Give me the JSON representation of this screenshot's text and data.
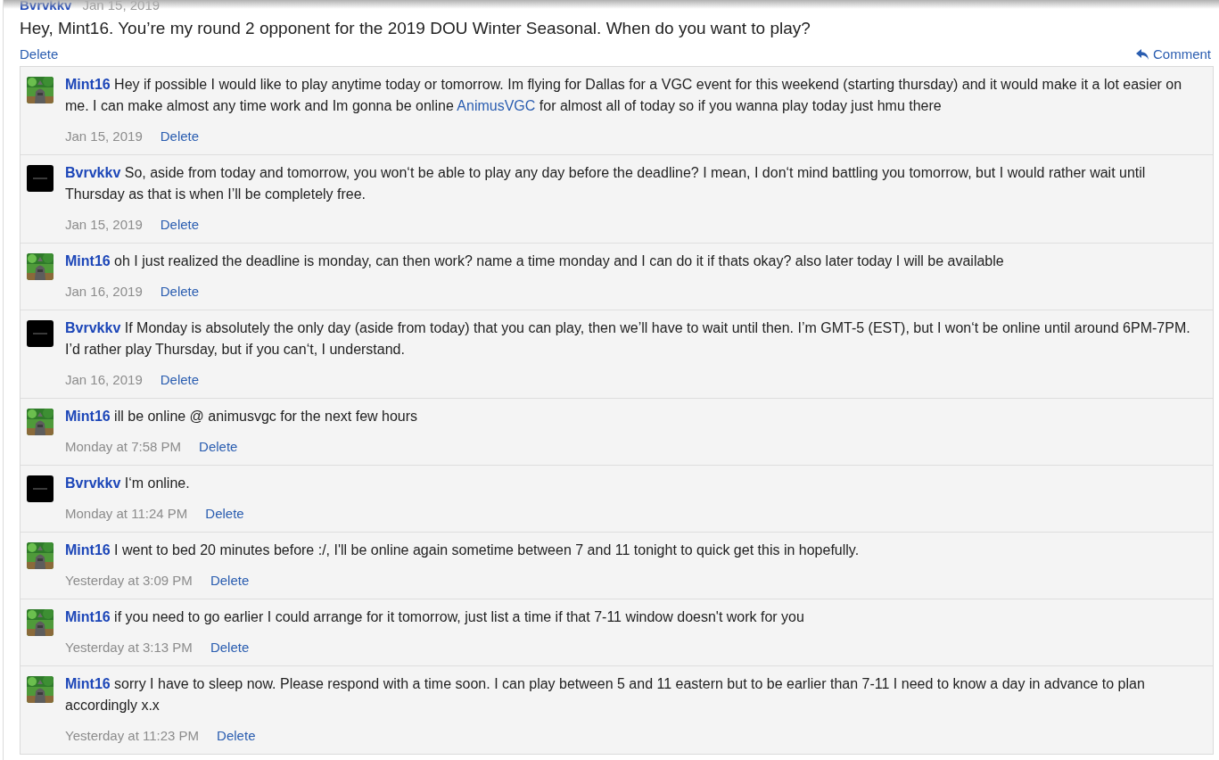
{
  "post_header": {
    "author": "Bvrvkkv",
    "date": "Jan 15, 2019"
  },
  "message": "Hey, Mint16. You’re my round 2 opponent for the 2019 DOU Winter Seasonal. When do you want to play?",
  "message_actions": {
    "delete": "Delete",
    "comment": "Comment"
  },
  "comments": [
    {
      "author": "Mint16",
      "avatar": {
        "kind": "grass"
      },
      "text_before": "Hey if possible I would like to play anytime today or tomorrow. Im flying for Dallas for a VGC event for this weekend (starting thursday) and it would make it a lot easier on me. I can make almost any time work and Im gonna be online",
      "link": "AnimusVGC",
      "text_after": "for almost all of today so if you wanna play today just hmu there",
      "date": "Jan 15, 2019",
      "delete": "Delete"
    },
    {
      "author": "Bvrvkkv",
      "avatar": {
        "kind": "dark"
      },
      "text_before": "So, aside from today and tomorrow, you won‘t be able to play any day before the deadline? I mean, I don‘t mind battling you tomorrow, but I would rather wait until Thursday as that is when I’ll be completely free.",
      "date": "Jan 15, 2019",
      "delete": "Delete"
    },
    {
      "author": "Mint16",
      "avatar": {
        "kind": "grass"
      },
      "text_before": "oh I just realized the deadline is monday, can then work? name a time monday and I can do it if thats okay? also later today I will be available",
      "date": "Jan 16, 2019",
      "delete": "Delete"
    },
    {
      "author": "Bvrvkkv",
      "avatar": {
        "kind": "dark"
      },
      "text_before": "If Monday is absolutely the only day (aside from today) that you can play, then we’ll have to wait until then. I’m GMT-5 (EST), but I won‘t be online until around 6PM-7PM. I’d rather play Thursday, but if you can‘t, I understand.",
      "date": "Jan 16, 2019",
      "delete": "Delete"
    },
    {
      "author": "Mint16",
      "avatar": {
        "kind": "grass"
      },
      "text_before": "ill be online @ animusvgc for the next few hours",
      "date": "Monday at 7:58 PM",
      "delete": "Delete"
    },
    {
      "author": "Bvrvkkv",
      "avatar": {
        "kind": "dark"
      },
      "text_before": "I‘m online.",
      "date": "Monday at 11:24 PM",
      "delete": "Delete"
    },
    {
      "author": "Mint16",
      "avatar": {
        "kind": "grass"
      },
      "text_before": "I went to bed 20 minutes before :/, I'll be online again sometime between 7 and 11 tonight to quick get this in hopefully.",
      "date": "Yesterday at 3:09 PM",
      "delete": "Delete"
    },
    {
      "author": "Mint16",
      "avatar": {
        "kind": "grass"
      },
      "text_before": "if you need to go earlier I could arrange for it tomorrow, just list a time if that 7-11 window doesn't work for you",
      "date": "Yesterday at 3:13 PM",
      "delete": "Delete"
    },
    {
      "author": "Mint16",
      "avatar": {
        "kind": "grass"
      },
      "text_before": "sorry I have to sleep now. Please respond with a time soon. I can play between 5 and 11 eastern but to be earlier than 7-11 I need to know a day in advance to plan accordingly x.x",
      "date": "Yesterday at 11:23 PM",
      "delete": "Delete"
    }
  ]
}
